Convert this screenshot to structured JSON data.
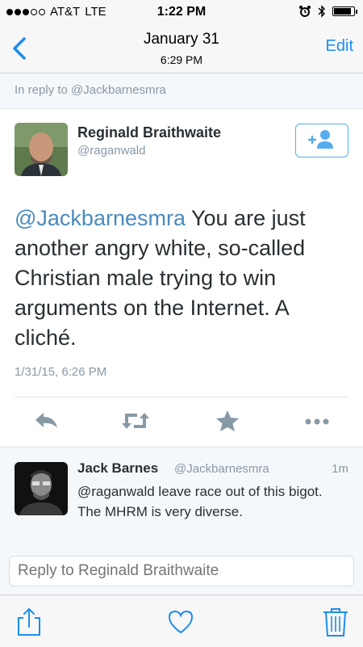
{
  "status_bar": {
    "carrier": "AT&T",
    "network": "LTE",
    "time": "1:22 PM",
    "signal_bars": 3,
    "signal_max": 5,
    "battery_level": 0.9,
    "icons": [
      "alarm-icon",
      "bluetooth-icon",
      "battery-icon"
    ]
  },
  "nav": {
    "back_icon": "chevron-left-icon",
    "title": "January 31",
    "subtitle": "6:29 PM",
    "edit_label": "Edit"
  },
  "reply_context": {
    "text": "In reply to @Jackbarnesmra"
  },
  "tweet": {
    "author_name": "Reginald Braithwaite",
    "author_handle": "@raganwald",
    "follow_icon": "add-user-icon",
    "mention": "@Jackbarnesmra",
    "body": " You are just another angry white, so-called Christian male trying to win arguments on the Internet. A cliché.",
    "timestamp": "1/31/15, 6:26 PM",
    "actions": [
      "reply-icon",
      "retweet-icon",
      "favorite-icon",
      "more-icon"
    ]
  },
  "reply": {
    "author_name": "Jack Barnes",
    "author_handle": "@Jackbarnesmra",
    "time": "1m",
    "text": "@raganwald leave race out of this bigot. The MHRM is very diverse."
  },
  "compose": {
    "placeholder": "Reply to Reginald Braithwaite"
  },
  "toolbar": {
    "icons": [
      "share-icon",
      "heart-icon",
      "trash-icon"
    ]
  },
  "colors": {
    "accent": "#1d8dee",
    "mention": "#4a8bbd",
    "secondary_text": "#8899a6",
    "action_icon": "#8899a6"
  }
}
